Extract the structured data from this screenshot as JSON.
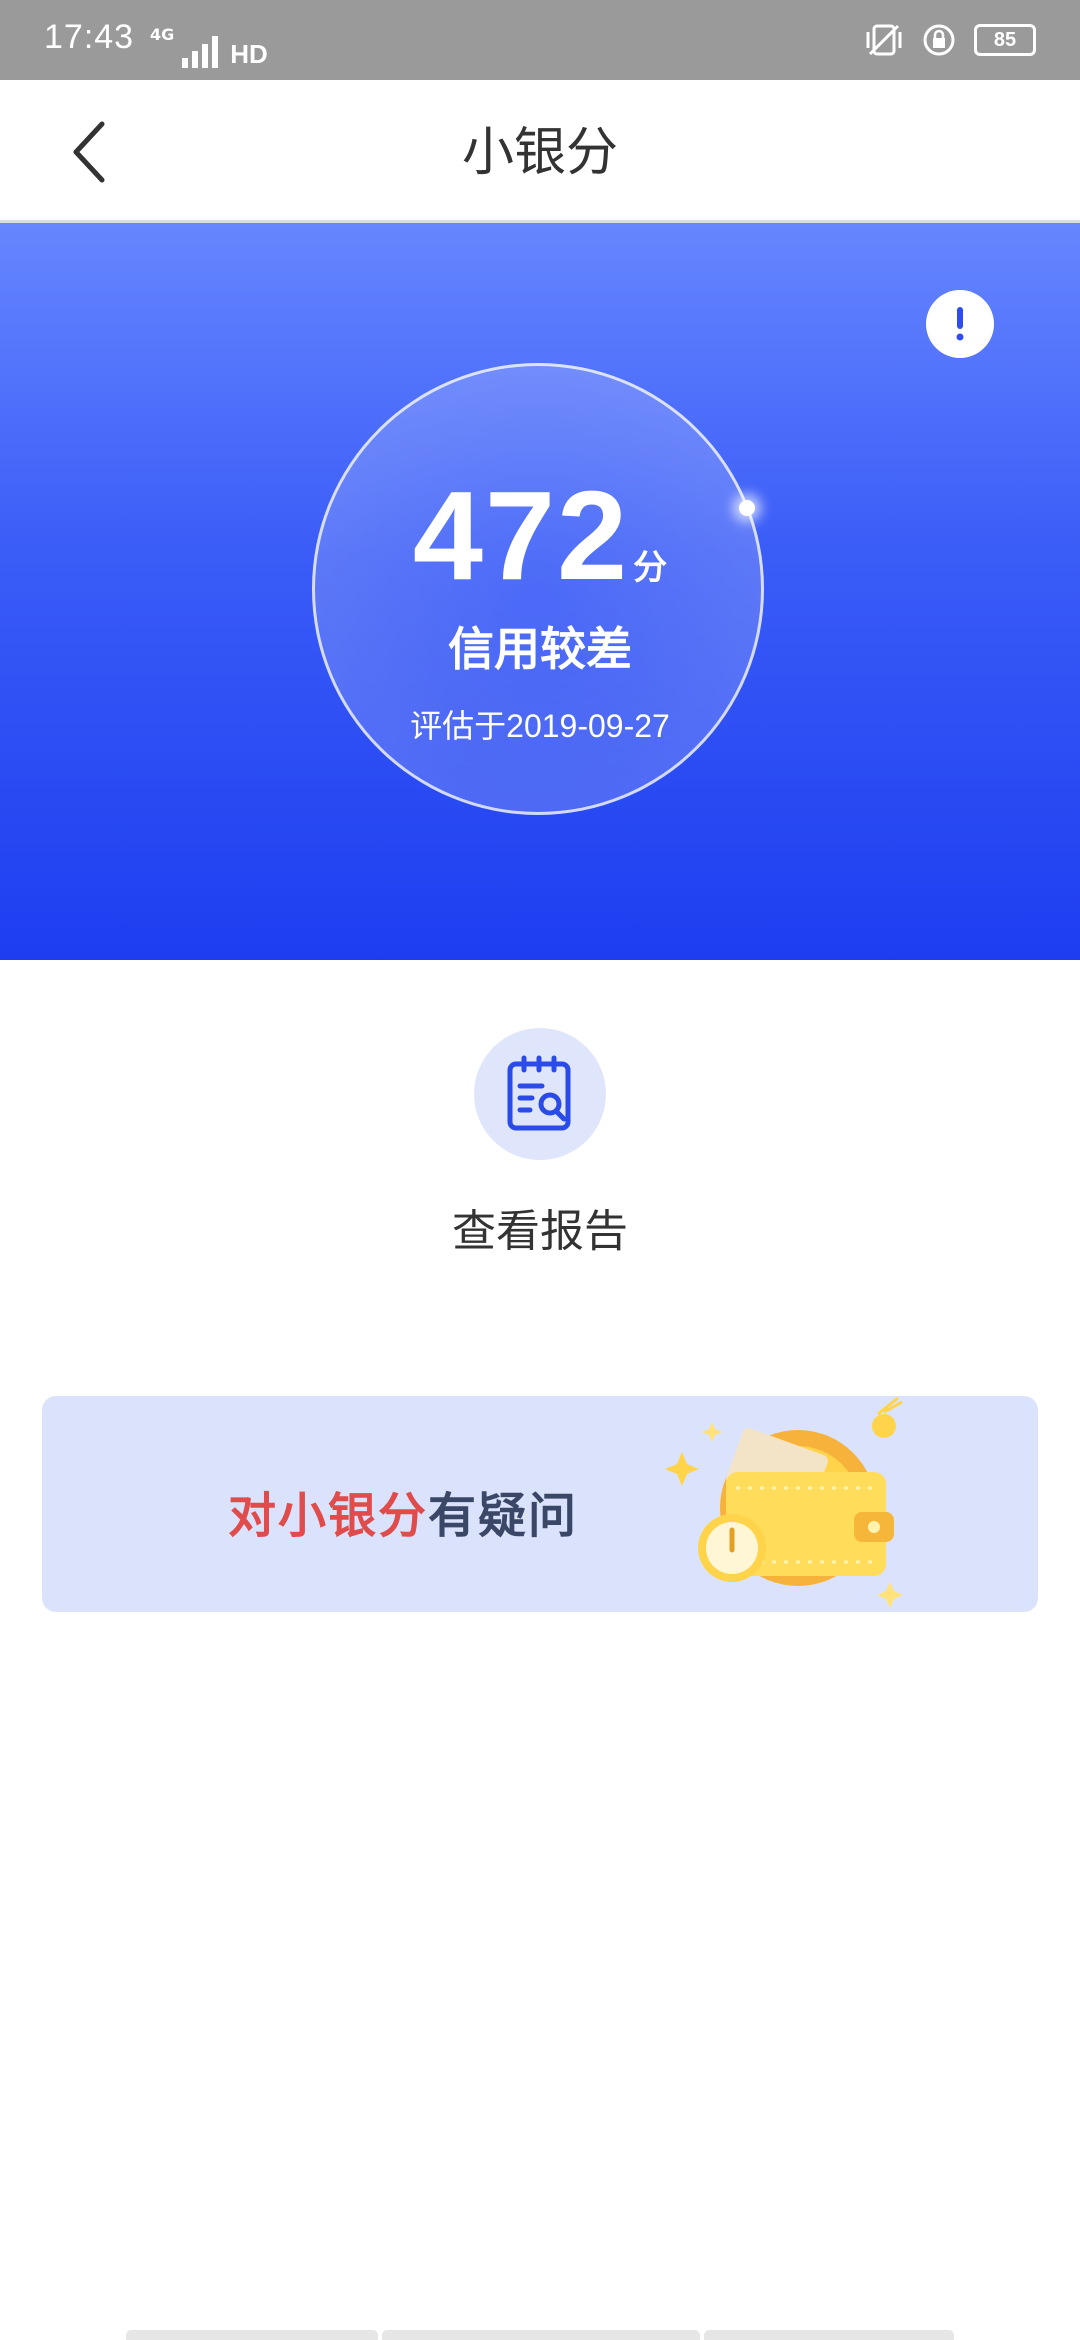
{
  "status_bar": {
    "time": "17:43",
    "network": "4G",
    "hd": "HD",
    "battery": "85"
  },
  "nav": {
    "title": "小银分"
  },
  "score": {
    "value": "472",
    "unit": "分",
    "level": "信用较差",
    "date": "评估于2019-09-27"
  },
  "report": {
    "label": "查看报告"
  },
  "banner": {
    "highlight": "对小银分",
    "rest": "有疑问"
  },
  "colors": {
    "hero_top": "#6686ff",
    "hero_bottom": "#1d3ef0",
    "accent_red": "#e04b4b",
    "banner_bg": "#dbe3fc"
  },
  "icons": [
    "back-icon",
    "info-icon",
    "report-icon",
    "wallet-illustration"
  ]
}
